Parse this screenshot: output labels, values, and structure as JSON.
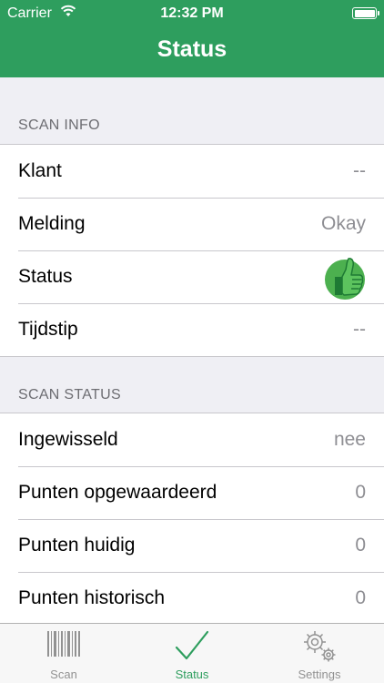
{
  "status_bar": {
    "carrier": "Carrier",
    "time": "12:32 PM"
  },
  "nav": {
    "title": "Status"
  },
  "scan_info": {
    "header": "SCAN INFO",
    "rows": [
      {
        "label": "Klant",
        "value": "--"
      },
      {
        "label": "Melding",
        "value": "Okay"
      },
      {
        "label": "Status",
        "icon": "thumbs-up-icon"
      },
      {
        "label": "Tijdstip",
        "value": "--"
      }
    ]
  },
  "scan_status": {
    "header": "SCAN STATUS",
    "rows": [
      {
        "label": "Ingewisseld",
        "value": "nee"
      },
      {
        "label": "Punten opgewaardeerd",
        "value": "0"
      },
      {
        "label": "Punten huidig",
        "value": "0"
      },
      {
        "label": "Punten historisch",
        "value": "0"
      }
    ]
  },
  "tabs": [
    {
      "label": "Scan",
      "icon": "barcode-icon"
    },
    {
      "label": "Status",
      "icon": "checkmark-icon",
      "active": true
    },
    {
      "label": "Settings",
      "icon": "gears-icon"
    }
  ],
  "colors": {
    "brand": "#2e9e5e",
    "inactive": "#929292",
    "thumb": "#4cb04f"
  }
}
